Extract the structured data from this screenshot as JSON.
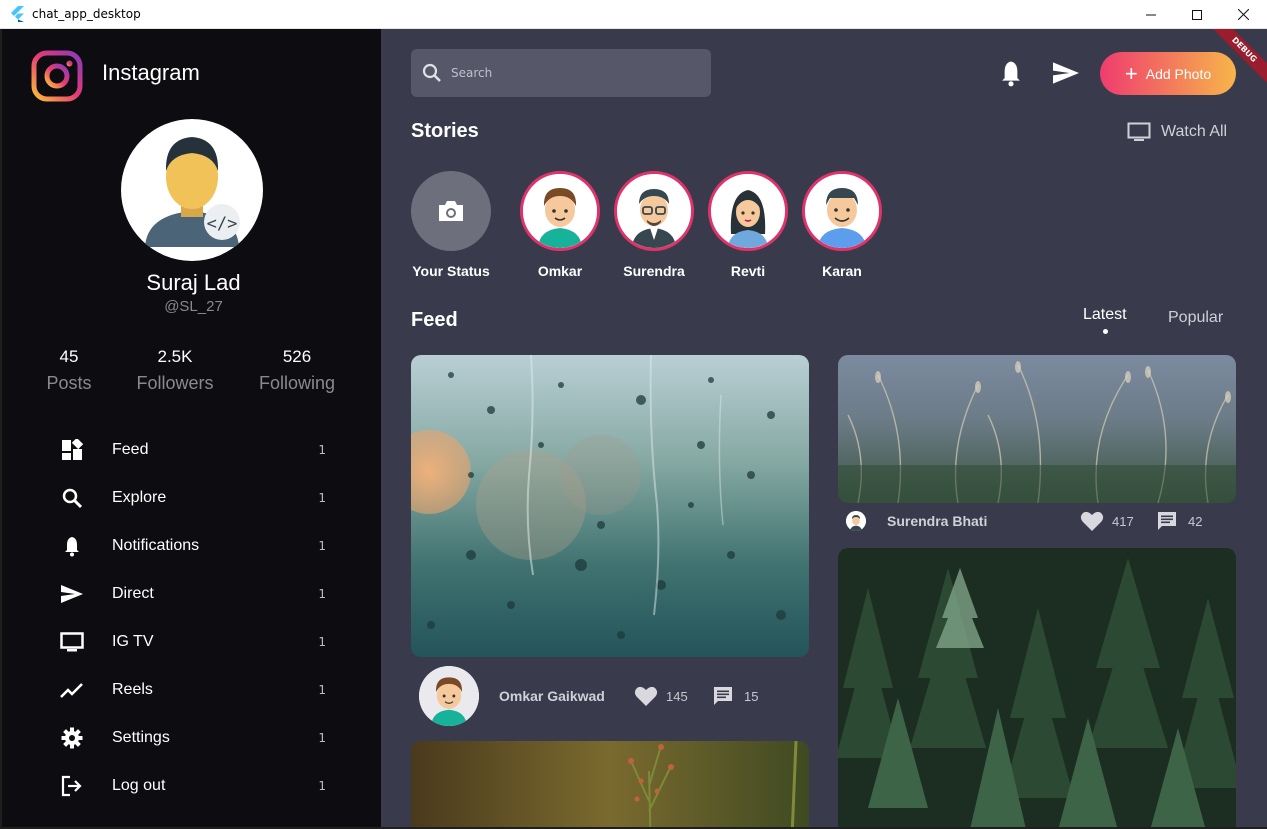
{
  "window": {
    "title": "chat_app_desktop",
    "controls": [
      "minimize",
      "maximize",
      "close"
    ]
  },
  "sidebar": {
    "brand": "Instagram",
    "profile": {
      "name": "Suraj Lad",
      "handle": "@SL_27"
    },
    "stats": [
      {
        "value": "45",
        "label": "Posts"
      },
      {
        "value": "2.5K",
        "label": "Followers"
      },
      {
        "value": "526",
        "label": "Following"
      }
    ],
    "nav": [
      {
        "label": "Feed",
        "count": "1",
        "icon": "dashboard-icon"
      },
      {
        "label": "Explore",
        "count": "1",
        "icon": "search-icon"
      },
      {
        "label": "Notifications",
        "count": "1",
        "icon": "bell-icon"
      },
      {
        "label": "Direct",
        "count": "1",
        "icon": "send-icon"
      },
      {
        "label": "IG TV",
        "count": "1",
        "icon": "tv-icon"
      },
      {
        "label": "Reels",
        "count": "1",
        "icon": "trending-icon"
      },
      {
        "label": "Settings",
        "count": "1",
        "icon": "gear-icon"
      },
      {
        "label": "Log out",
        "count": "1",
        "icon": "logout-icon"
      }
    ]
  },
  "header": {
    "search_placeholder": "Search",
    "add_photo_label": "Add Photo",
    "debug_banner": "DEBUG"
  },
  "stories": {
    "title": "Stories",
    "watch_all": "Watch All",
    "items": [
      {
        "name": "Your Status"
      },
      {
        "name": "Omkar"
      },
      {
        "name": "Surendra"
      },
      {
        "name": "Revti"
      },
      {
        "name": "Karan"
      }
    ]
  },
  "feed": {
    "title": "Feed",
    "tabs": [
      {
        "label": "Latest",
        "active": true
      },
      {
        "label": "Popular",
        "active": false
      }
    ],
    "posts": [
      {
        "author": "Omkar Gaikwad",
        "likes": "145",
        "comments": "15"
      },
      {
        "author": "Surendra Bhati",
        "likes": "417",
        "comments": "42"
      }
    ]
  },
  "colors": {
    "sidebar_bg": "#0d0c10",
    "main_bg": "#393b4d",
    "accent_gradient_start": "#ef3c6e",
    "accent_gradient_end": "#f7b54a",
    "story_ring": "#e0336a"
  }
}
